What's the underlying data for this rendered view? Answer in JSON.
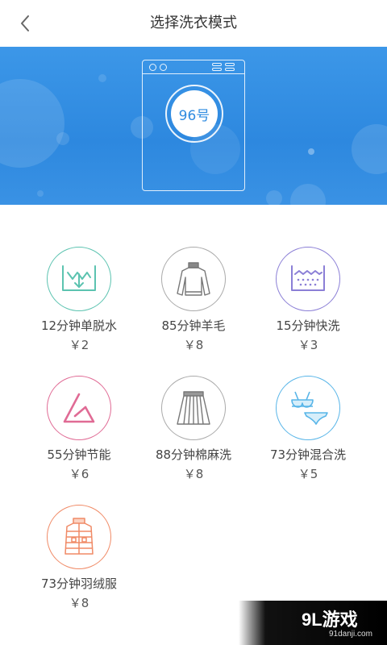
{
  "header": {
    "title": "选择洗衣模式"
  },
  "banner": {
    "machine_number": "96号"
  },
  "modes": [
    {
      "name": "12分钟单脱水",
      "price": "￥2",
      "icon": "spin-dry-icon",
      "color": "#5cc3b0"
    },
    {
      "name": "85分钟羊毛",
      "price": "￥8",
      "icon": "sweater-icon",
      "color": "#aaaaaa"
    },
    {
      "name": "15分钟快洗",
      "price": "￥3",
      "icon": "quick-wash-icon",
      "color": "#8b7fd6"
    },
    {
      "name": "55分钟节能",
      "price": "￥6",
      "icon": "eco-triangle-icon",
      "color": "#e06b95"
    },
    {
      "name": "88分钟棉麻洗",
      "price": "￥8",
      "icon": "skirt-icon",
      "color": "#aaaaaa"
    },
    {
      "name": "73分钟混合洗",
      "price": "￥5",
      "icon": "underwear-icon",
      "color": "#58b5e8"
    },
    {
      "name": "73分钟羽绒服",
      "price": "￥8",
      "icon": "down-jacket-icon",
      "color": "#f08a66"
    }
  ],
  "watermark": {
    "logo": "9L游戏",
    "url": "91danji.com"
  }
}
